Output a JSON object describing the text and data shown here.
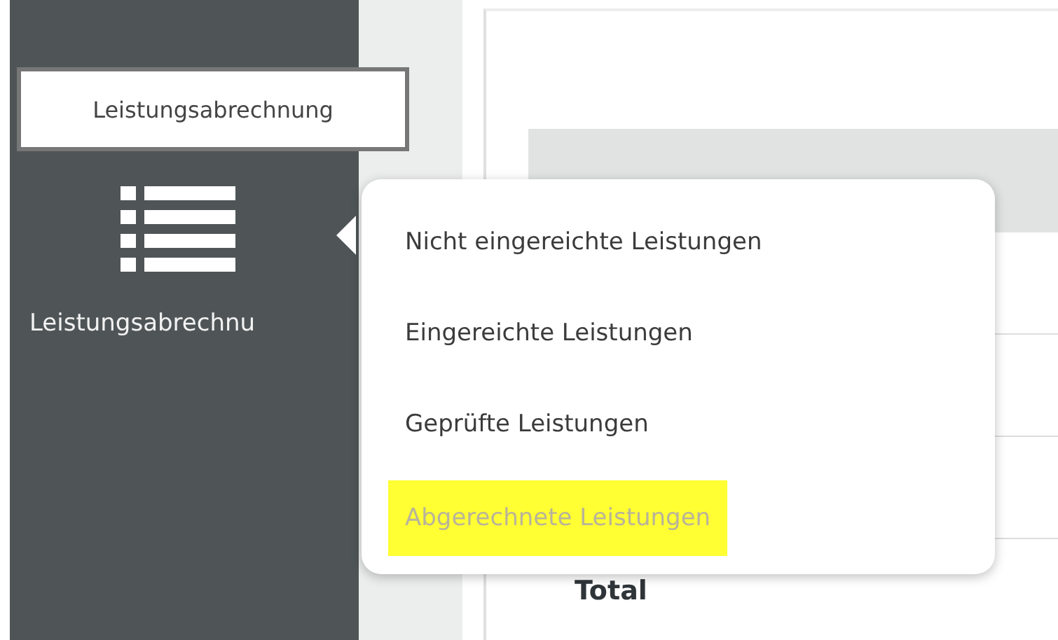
{
  "sidebar": {
    "tooltip": "Leistungsabrechnung",
    "items": [
      {
        "label": "Leistungsabrechnu",
        "selected": true
      }
    ]
  },
  "menu": {
    "items": [
      {
        "label": "Nicht eingereichte Leistungen",
        "disabled": false,
        "highlighted": false
      },
      {
        "label": "Eingereichte Leistungen",
        "disabled": false,
        "highlighted": false
      },
      {
        "label": "Geprüfte Leistungen",
        "disabled": false,
        "highlighted": false
      },
      {
        "label": "Abgerechnete Leistungen",
        "disabled": true,
        "highlighted": true
      }
    ]
  },
  "table": {
    "total_label": "Total"
  }
}
